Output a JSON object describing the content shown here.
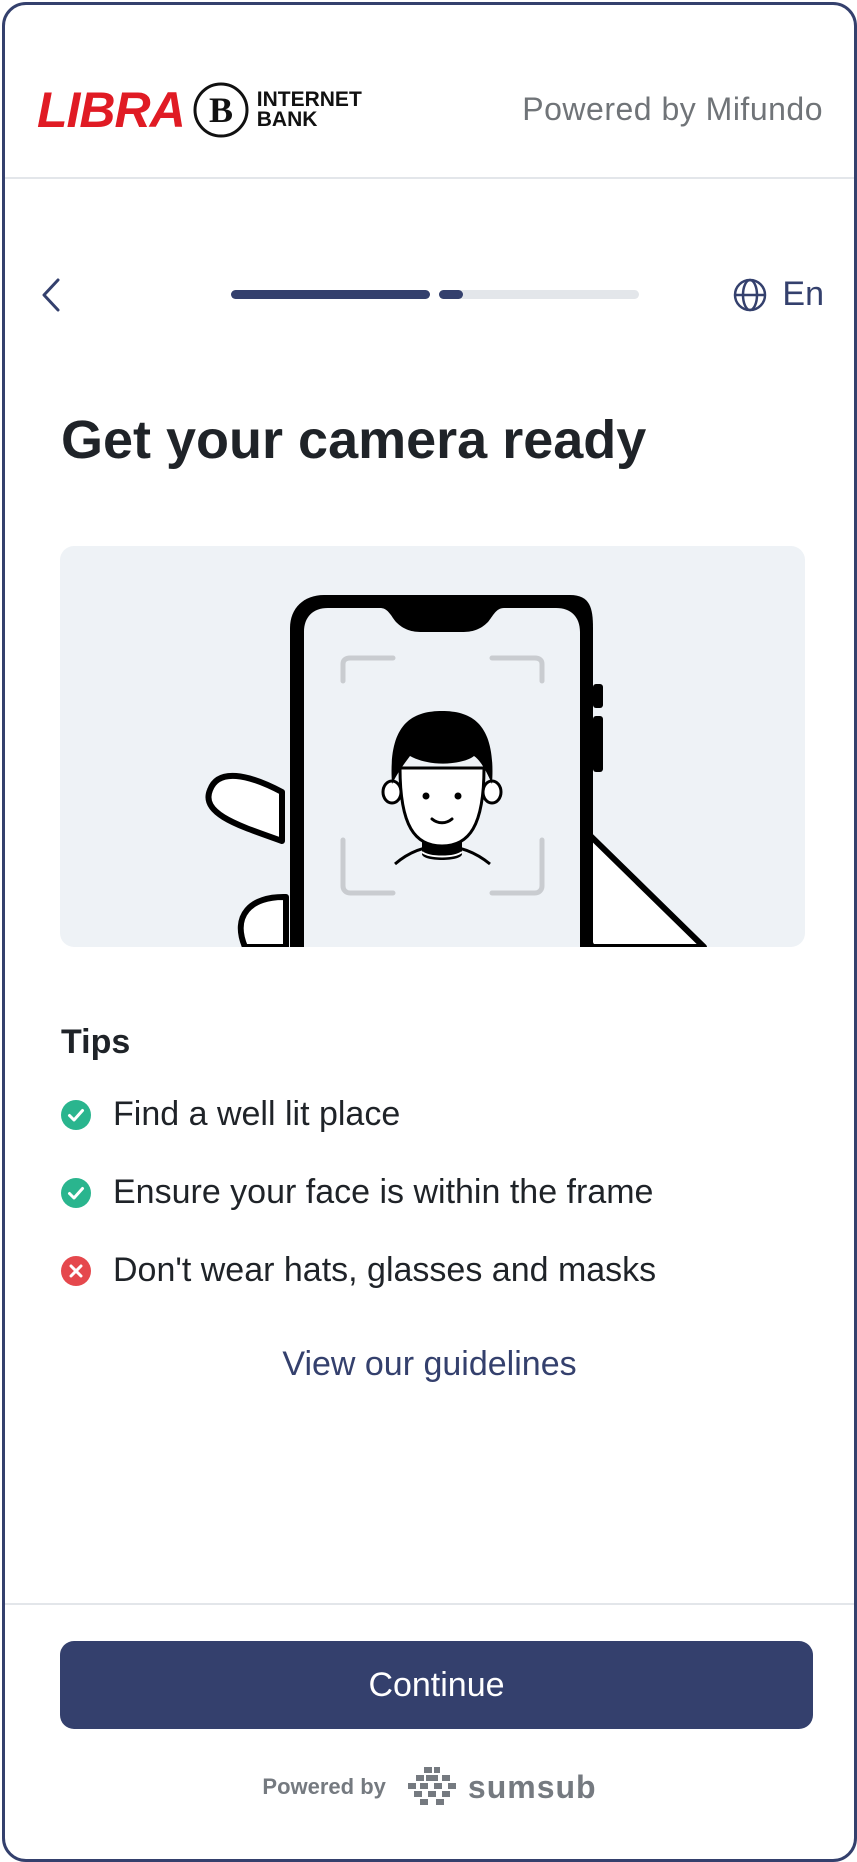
{
  "header": {
    "logo_text": "LIBRA",
    "logo_emblem": "B",
    "logo_bank_line1": "INTERNET",
    "logo_bank_line2": "BANK",
    "powered_by": "Powered by Mifundo"
  },
  "nav": {
    "back_icon": "chevron-left-icon",
    "progress": {
      "steps_total": 2,
      "step_1_fraction": 1.0,
      "step_2_fraction": 0.12
    },
    "language_icon": "globe-icon",
    "language_label": "En"
  },
  "main": {
    "title": "Get your camera ready",
    "tips_heading": "Tips",
    "tips": [
      {
        "text": "Find a well lit place",
        "status": "ok",
        "icon": "check-circle-icon"
      },
      {
        "text": "Ensure your face is within the frame",
        "status": "ok",
        "icon": "check-circle-icon"
      },
      {
        "text": "Don't wear hats, glasses and masks",
        "status": "bad",
        "icon": "x-circle-icon"
      }
    ],
    "guidelines_link": "View our guidelines"
  },
  "footer": {
    "continue_label": "Continue",
    "powered_by": "Powered by",
    "brand": "sumsub"
  },
  "colors": {
    "accent": "#34406d",
    "brand_red": "#e01b24",
    "ok": "#2ab58e",
    "bad": "#e5484d",
    "illustration_bg": "#eef2f6"
  }
}
